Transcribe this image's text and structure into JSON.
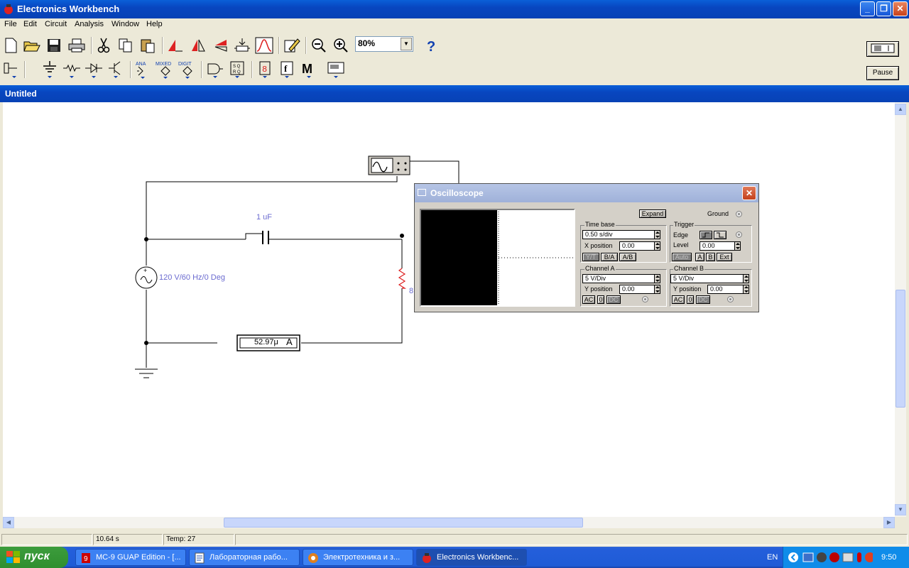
{
  "window": {
    "title": "Electronics Workbench"
  },
  "menu": [
    "File",
    "Edit",
    "Circuit",
    "Analysis",
    "Window",
    "Help"
  ],
  "toolbar": {
    "zoom": "80%",
    "pause_label": "Pause"
  },
  "document": {
    "title": "Untitled"
  },
  "circuit": {
    "capacitor_label": "1 uF",
    "source_label": "120 V/60 Hz/0 Deg",
    "resistor_label": "8",
    "ammeter_value": "52.97μ",
    "ammeter_unit": "A"
  },
  "oscilloscope": {
    "title": "Oscilloscope",
    "expand": "Expand",
    "ground": "Ground",
    "time_base": "Time base",
    "time_base_value": "0.50 s/div",
    "x_position_label": "X position",
    "x_position_value": "0.00",
    "mode_buttons": [
      "Y/T",
      "B/A",
      "A/B"
    ],
    "trigger": "Trigger",
    "edge": "Edge",
    "level_label": "Level",
    "level_value": "0.00",
    "trigger_buttons": [
      "Auto",
      "A",
      "B",
      "Ext"
    ],
    "channel_a": {
      "title": "Channel A",
      "volts": "5  V/Div",
      "y_position_label": "Y position",
      "y_position_value": "0.00",
      "coupling": [
        "AC",
        "0",
        "DC"
      ]
    },
    "channel_b": {
      "title": "Channel B",
      "volts": "5  V/Div",
      "y_position_label": "Y position",
      "y_position_value": "0.00",
      "coupling": [
        "AC",
        "0",
        "DC"
      ]
    }
  },
  "status": {
    "time": "10.64 s",
    "temp": "Temp:  27"
  },
  "taskbar": {
    "start": "пуск",
    "tasks": [
      "MC-9 GUAP Edition - [...",
      "Лабораторная рабо...",
      "Электротехника и з...",
      "Electronics Workbenc..."
    ],
    "lang": "EN",
    "clock": "9:50"
  }
}
